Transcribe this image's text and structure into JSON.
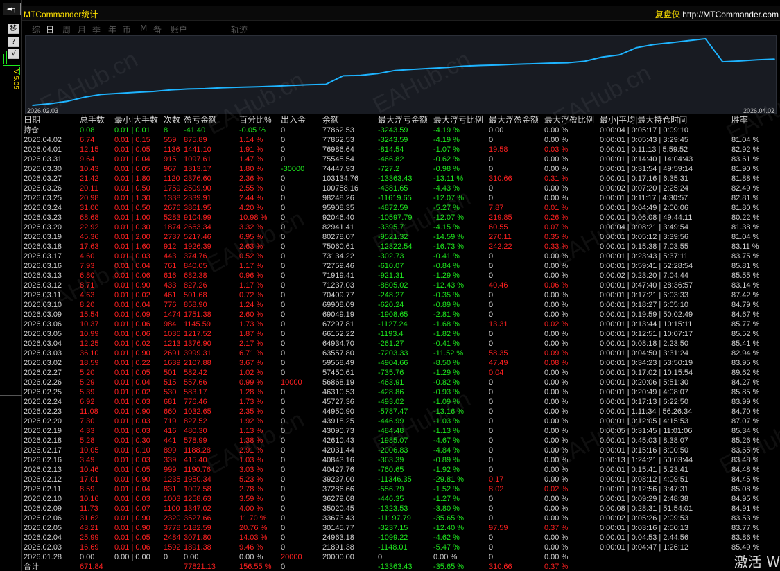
{
  "app": {
    "title": "MTCommander统计",
    "brand_name": "复盘侠",
    "brand_url": "http://MTCommander.com"
  },
  "sidebar": {
    "top_button": "◄┐",
    "btn1": "移",
    "btn2": "?",
    "btn3": "√",
    "vtext": "V 5.05"
  },
  "tabs": [
    {
      "label": "综"
    },
    {
      "label": "日"
    },
    {
      "label": "周"
    },
    {
      "label": "月"
    },
    {
      "label": "季"
    },
    {
      "label": "年"
    },
    {
      "label": "币"
    },
    {
      "label": "M"
    },
    {
      "label": "备"
    },
    {
      "label": "账户"
    },
    {
      "label": "轨迹"
    }
  ],
  "active_tab": "日",
  "colors": {
    "line": "#1eb4ff",
    "up": "#1ee81e",
    "down": "#ff2020",
    "title": "#ffe100"
  },
  "chart_data": {
    "type": "line",
    "x_start": "2026.02.03",
    "x_end": "2026.04.02",
    "x": [
      "2026.01.28",
      "2026.02.03",
      "2026.02.04",
      "2026.02.05",
      "2026.02.06",
      "2026.02.09",
      "2026.02.10",
      "2026.02.11",
      "2026.02.12",
      "2026.02.13",
      "2026.02.16",
      "2026.02.17",
      "2026.02.18",
      "2026.02.19",
      "2026.02.20",
      "2026.02.23",
      "2026.02.24",
      "2026.02.25",
      "2026.02.26",
      "2026.02.27",
      "2026.03.02",
      "2026.03.03",
      "2026.03.04",
      "2026.03.05",
      "2026.03.06",
      "2026.03.09",
      "2026.03.10",
      "2026.03.11",
      "2026.03.12",
      "2026.03.13",
      "2026.03.16",
      "2026.03.17",
      "2026.03.18",
      "2026.03.19",
      "2026.03.20",
      "2026.03.23",
      "2026.03.24",
      "2026.03.25",
      "2026.03.26",
      "2026.03.27",
      "2026.03.30",
      "2026.03.31",
      "2026.04.01",
      "2026.04.02"
    ],
    "values": [
      20000.0,
      21891.38,
      24963.18,
      30145.77,
      33673.43,
      35020.45,
      36279.08,
      37286.66,
      39237.0,
      40427.76,
      40843.16,
      42031.44,
      42610.43,
      43090.73,
      43918.25,
      44950.9,
      45727.36,
      46310.53,
      56868.19,
      57450.61,
      59558.49,
      63557.8,
      64934.7,
      66152.22,
      67297.81,
      69049.19,
      69908.09,
      70409.77,
      71237.03,
      71919.41,
      72759.46,
      73134.22,
      75060.61,
      80278.07,
      82941.41,
      92046.4,
      95908.35,
      98248.26,
      100758.16,
      103134.76,
      74447.93,
      75545.54,
      76986.64,
      77862.53
    ],
    "grid": false
  },
  "table": {
    "headers": [
      "日期",
      "总手数",
      "最小|大手数",
      "次数",
      "盈亏金额",
      "百分比%",
      "出入金",
      "余额",
      "最大浮亏金额",
      "最大浮亏比例",
      "最大浮盈金额",
      "最大浮盈比例",
      "最小|平均|最大持仓时间",
      "胜率"
    ],
    "holding": [
      "持仓",
      "0.08",
      "0.01 | 0.01",
      "8",
      "-41.40",
      "-0.05 %",
      "0",
      "77862.53",
      "-3243.59",
      "-4.19 %",
      "0.00",
      "0.00 %",
      "0:00:04 | 0:05:17 | 0:09:10",
      ""
    ],
    "rows": [
      [
        "2026.04.02",
        "6.74",
        "0.01 | 0.15",
        "559",
        "875.89",
        "1.14 %",
        "0",
        "77862.53",
        "-3243.59",
        "-4.19 %",
        "0",
        "0.00 %",
        "0:00:01 | 0:05:43 | 3:29:45",
        "81.04 %"
      ],
      [
        "2026.04.01",
        "12.15",
        "0.01 | 0.05",
        "1136",
        "1441.10",
        "1.91 %",
        "0",
        "76986.64",
        "-814.54",
        "-1.07 %",
        "19.58",
        "0.03 %",
        "0:00:01 | 0:11:13 | 5:59:52",
        "82.92 %"
      ],
      [
        "2026.03.31",
        "9.64",
        "0.01 | 0.04",
        "915",
        "1097.61",
        "1.47 %",
        "0",
        "75545.54",
        "-466.82",
        "-0.62 %",
        "0",
        "0.00 %",
        "0:00:01 | 0:14:40 | 14:04:43",
        "83.61 %"
      ],
      [
        "2026.03.30",
        "10.43",
        "0.01 | 0.05",
        "967",
        "1313.17",
        "1.80 %",
        "-30000",
        "74447.93",
        "-727.2",
        "-0.98 %",
        "0",
        "0.00 %",
        "0:00:01 | 0:31:54 | 49:59:14",
        "81.90 %"
      ],
      [
        "2026.03.27",
        "21.42",
        "0.01 | 1.80",
        "1120",
        "2376.60",
        "2.36 %",
        "0",
        "103134.76",
        "-13363.43",
        "-13.11 %",
        "310.66",
        "0.31 %",
        "0:00:01 | 0:17:16 | 6:35:31",
        "81.88 %"
      ],
      [
        "2026.03.26",
        "20.11",
        "0.01 | 0.50",
        "1759",
        "2509.90",
        "2.55 %",
        "0",
        "100758.16",
        "-4381.65",
        "-4.43 %",
        "0",
        "0.00 %",
        "0:00:02 | 0:07:20 | 2:25:24",
        "82.49 %"
      ],
      [
        "2026.03.25",
        "20.98",
        "0.01 | 1.30",
        "1338",
        "2339.91",
        "2.44 %",
        "0",
        "98248.26",
        "-11619.65",
        "-12.07 %",
        "0",
        "0.00 %",
        "0:00:01 | 0:11:17 | 4:30:57",
        "82.81 %"
      ],
      [
        "2026.03.24",
        "31.00",
        "0.01 | 0.50",
        "2676",
        "3861.95",
        "4.20 %",
        "0",
        "95908.35",
        "-4872.59",
        "-5.27 %",
        "7.87",
        "0.01 %",
        "0:00:01 | 0:04:49 | 2:00:06",
        "81.80 %"
      ],
      [
        "2026.03.23",
        "68.68",
        "0.01 | 1.00",
        "5283",
        "9104.99",
        "10.98 %",
        "0",
        "92046.40",
        "-10597.79",
        "-12.07 %",
        "219.85",
        "0.26 %",
        "0:00:01 | 0:06:08 | 49:44:11",
        "80.22 %"
      ],
      [
        "2026.03.20",
        "22.92",
        "0.01 | 0.30",
        "1874",
        "2663.34",
        "3.32 %",
        "0",
        "82941.41",
        "-3395.71",
        "-4.15 %",
        "60.55",
        "0.07 %",
        "0:00:04 | 0:08:21 | 3:49:54",
        "81.38 %"
      ],
      [
        "2026.03.19",
        "45.36",
        "0.01 | 2.00",
        "2737",
        "5217.46",
        "6.95 %",
        "0",
        "80278.07",
        "-9521.32",
        "-14.59 %",
        "270.11",
        "0.35 %",
        "0:00:01 | 0:05:12 | 3:39:56",
        "81.04 %"
      ],
      [
        "2026.03.18",
        "17.63",
        "0.01 | 1.60",
        "912",
        "1926.39",
        "2.63 %",
        "0",
        "75060.61",
        "-12322.54",
        "-16.73 %",
        "242.22",
        "0.33 %",
        "0:00:01 | 0:15:38 | 7:03:55",
        "83.11 %"
      ],
      [
        "2026.03.17",
        "4.60",
        "0.01 | 0.03",
        "443",
        "374.76",
        "0.52 %",
        "0",
        "73134.22",
        "-302.73",
        "-0.41 %",
        "0",
        "0.00 %",
        "0:00:01 | 0:23:43 | 5:37:11",
        "83.75 %"
      ],
      [
        "2026.03.16",
        "7.93",
        "0.01 | 0.04",
        "761",
        "840.05",
        "1.17 %",
        "0",
        "72759.46",
        "-610.07",
        "-0.84 %",
        "0",
        "0.00 %",
        "0:00:01 | 0:59:41 | 52:28:54",
        "85.81 %"
      ],
      [
        "2026.03.13",
        "6.80",
        "0.01 | 0.06",
        "616",
        "682.38",
        "0.96 %",
        "0",
        "71919.41",
        "-921.31",
        "-1.29 %",
        "0",
        "0.00 %",
        "0:00:02 | 0:23:20 | 7:04:44",
        "85.55 %"
      ],
      [
        "2026.03.12",
        "8.71",
        "0.01 | 0.90",
        "433",
        "827.26",
        "1.17 %",
        "0",
        "71237.03",
        "-8805.02",
        "-12.43 %",
        "40.46",
        "0.06 %",
        "0:00:01 | 0:47:40 | 28:36:57",
        "83.14 %"
      ],
      [
        "2026.03.11",
        "4.63",
        "0.01 | 0.02",
        "461",
        "501.68",
        "0.72 %",
        "0",
        "70409.77",
        "-248.27",
        "-0.35 %",
        "0",
        "0.00 %",
        "0:00:01 | 0:17:21 | 6:03:33",
        "87.42 %"
      ],
      [
        "2026.03.10",
        "8.20",
        "0.01 | 0.04",
        "776",
        "858.90",
        "1.24 %",
        "0",
        "69908.09",
        "-620.24",
        "-0.89 %",
        "0",
        "0.00 %",
        "0:00:01 | 0:18:27 | 6:05:10",
        "84.79 %"
      ],
      [
        "2026.03.09",
        "15.54",
        "0.01 | 0.09",
        "1474",
        "1751.38",
        "2.60 %",
        "0",
        "69049.19",
        "-1908.65",
        "-2.81 %",
        "0",
        "0.00 %",
        "0:00:01 | 0:19:59 | 50:02:49",
        "84.67 %"
      ],
      [
        "2026.03.06",
        "10.37",
        "0.01 | 0.06",
        "984",
        "1145.59",
        "1.73 %",
        "0",
        "67297.81",
        "-1127.24",
        "-1.68 %",
        "13.31",
        "0.02 %",
        "0:00:01 | 0:13:44 | 10:15:11",
        "85.77 %"
      ],
      [
        "2026.03.05",
        "10.99",
        "0.01 | 0.06",
        "1036",
        "1217.52",
        "1.87 %",
        "0",
        "66152.22",
        "-1193.4",
        "-1.82 %",
        "0",
        "0.00 %",
        "0:00:01 | 0:12:51 | 10:07:17",
        "85.52 %"
      ],
      [
        "2026.03.04",
        "12.25",
        "0.01 | 0.02",
        "1213",
        "1376.90",
        "2.17 %",
        "0",
        "64934.70",
        "-261.27",
        "-0.41 %",
        "0",
        "0.00 %",
        "0:00:01 | 0:08:18 | 2:23:50",
        "85.41 %"
      ],
      [
        "2026.03.03",
        "36.10",
        "0.01 | 0.90",
        "2691",
        "3999.31",
        "6.71 %",
        "0",
        "63557.80",
        "-7203.33",
        "-11.52 %",
        "58.35",
        "0.09 %",
        "0:00:01 | 0:04:50 | 3:31:24",
        "82.94 %"
      ],
      [
        "2026.03.02",
        "18.59",
        "0.01 | 0.22",
        "1639",
        "2107.88",
        "3.67 %",
        "0",
        "59558.49",
        "-4904.66",
        "-8.50 %",
        "47.49",
        "0.08 %",
        "0:00:01 | 0:34:23 | 53:50:19",
        "83.95 %"
      ],
      [
        "2026.02.27",
        "5.20",
        "0.01 | 0.05",
        "501",
        "582.42",
        "1.02 %",
        "0",
        "57450.61",
        "-735.76",
        "-1.29 %",
        "0.04",
        "0.00 %",
        "0:00:01 | 0:17:02 | 10:15:54",
        "89.62 %"
      ],
      [
        "2026.02.26",
        "5.29",
        "0.01 | 0.04",
        "515",
        "557.66",
        "0.99 %",
        "10000",
        "56868.19",
        "-463.91",
        "-0.82 %",
        "0",
        "0.00 %",
        "0:00:01 | 0:20:06 | 5:51:30",
        "84.27 %"
      ],
      [
        "2026.02.25",
        "5.39",
        "0.01 | 0.02",
        "530",
        "583.17",
        "1.28 %",
        "0",
        "46310.53",
        "-428.86",
        "-0.93 %",
        "0",
        "0.00 %",
        "0:00:01 | 0:20:49 | 4:08:07",
        "85.85 %"
      ],
      [
        "2026.02.24",
        "6.92",
        "0.01 | 0.03",
        "681",
        "776.46",
        "1.73 %",
        "0",
        "45727.36",
        "-493.02",
        "-1.09 %",
        "0",
        "0.00 %",
        "0:00:01 | 0:17:13 | 6:22:50",
        "83.99 %"
      ],
      [
        "2026.02.23",
        "11.08",
        "0.01 | 0.90",
        "660",
        "1032.65",
        "2.35 %",
        "0",
        "44950.90",
        "-5787.47",
        "-13.16 %",
        "0",
        "0.00 %",
        "0:00:01 | 1:11:34 | 56:26:34",
        "84.70 %"
      ],
      [
        "2026.02.20",
        "7.30",
        "0.01 | 0.03",
        "719",
        "827.52",
        "1.92 %",
        "0",
        "43918.25",
        "-446.99",
        "-1.03 %",
        "0",
        "0.00 %",
        "0:00:01 | 0:12:05 | 4:15:53",
        "87.07 %"
      ],
      [
        "2026.02.19",
        "4.33",
        "0.01 | 0.03",
        "416",
        "480.30",
        "1.13 %",
        "0",
        "43090.73",
        "-484.48",
        "-1.13 %",
        "0",
        "0.00 %",
        "0:00:05 | 0:31:45 | 11:01:06",
        "85.34 %"
      ],
      [
        "2026.02.18",
        "5.28",
        "0.01 | 0.30",
        "441",
        "578.99",
        "1.38 %",
        "0",
        "42610.43",
        "-1985.07",
        "-4.67 %",
        "0",
        "0.00 %",
        "0:00:01 | 0:45:03 | 8:38:07",
        "85.26 %"
      ],
      [
        "2026.02.17",
        "10.05",
        "0.01 | 0.10",
        "899",
        "1188.28",
        "2.91 %",
        "0",
        "42031.44",
        "-2006.83",
        "-4.84 %",
        "0",
        "0.00 %",
        "0:00:01 | 0:15:16 | 8:00:50",
        "83.65 %"
      ],
      [
        "2026.02.16",
        "3.49",
        "0.01 | 0.03",
        "339",
        "415.40",
        "1.03 %",
        "0",
        "40843.16",
        "-363.39",
        "-0.89 %",
        "0",
        "0.00 %",
        "0:00:13 | 1:24:21 | 50:03:44",
        "83.48 %"
      ],
      [
        "2026.02.13",
        "10.46",
        "0.01 | 0.05",
        "999",
        "1190.76",
        "3.03 %",
        "0",
        "40427.76",
        "-760.65",
        "-1.92 %",
        "0",
        "0.00 %",
        "0:00:01 | 0:15:41 | 5:23:41",
        "84.48 %"
      ],
      [
        "2026.02.12",
        "17.01",
        "0.01 | 0.90",
        "1235",
        "1950.34",
        "5.23 %",
        "0",
        "39237.00",
        "-11346.35",
        "-29.81 %",
        "0.17",
        "0.00 %",
        "0:00:01 | 0:08:12 | 4:09:51",
        "84.45 %"
      ],
      [
        "2026.02.11",
        "8.59",
        "0.01 | 0.04",
        "831",
        "1007.58",
        "2.78 %",
        "0",
        "37286.66",
        "-556.79",
        "-1.52 %",
        "8.02",
        "0.02 %",
        "0:00:01 | 0:12:56 | 3:47:31",
        "85.08 %"
      ],
      [
        "2026.02.10",
        "10.16",
        "0.01 | 0.03",
        "1003",
        "1258.63",
        "3.59 %",
        "0",
        "36279.08",
        "-446.35",
        "-1.27 %",
        "0",
        "0.00 %",
        "0:00:01 | 0:09:29 | 2:48:38",
        "84.95 %"
      ],
      [
        "2026.02.09",
        "11.73",
        "0.01 | 0.07",
        "1100",
        "1347.02",
        "4.00 %",
        "0",
        "35020.45",
        "-1323.53",
        "-3.80 %",
        "0",
        "0.00 %",
        "0:00:08 | 0:28:31 | 51:54:01",
        "84.91 %"
      ],
      [
        "2026.02.06",
        "31.62",
        "0.01 | 0.90",
        "2320",
        "3527.66",
        "11.70 %",
        "0",
        "33673.43",
        "-11197.79",
        "-35.65 %",
        "0",
        "0.00 %",
        "0:00:02 | 0:05:26 | 2:09:53",
        "83.53 %"
      ],
      [
        "2026.02.05",
        "43.21",
        "0.01 | 0.90",
        "3778",
        "5182.59",
        "20.76 %",
        "0",
        "30145.77",
        "-3237.15",
        "-12.40 %",
        "97.59",
        "0.37 %",
        "0:00:01 | 0:03:16 | 2:50:13",
        "83.77 %"
      ],
      [
        "2026.02.04",
        "25.99",
        "0.01 | 0.05",
        "2484",
        "3071.80",
        "14.03 %",
        "0",
        "24963.18",
        "-1099.22",
        "-4.62 %",
        "0",
        "0.00 %",
        "0:00:01 | 0:04:53 | 2:44:56",
        "83.86 %"
      ],
      [
        "2026.02.03",
        "16.69",
        "0.01 | 0.06",
        "1592",
        "1891.38",
        "9.46 %",
        "0",
        "21891.38",
        "-1148.01",
        "-5.47 %",
        "0",
        "0.00 %",
        "0:00:01 | 0:04:47 | 1:26:12",
        "85.49 %"
      ],
      [
        "2026.01.28",
        "0.00",
        "0.00 | 0.00",
        "0",
        "0.00",
        "0.00 %",
        "20000",
        "20000.00",
        "0",
        "0.00 %",
        "0",
        "0.00 %",
        "",
        ""
      ]
    ],
    "total": [
      "合计",
      "671.84",
      "",
      "",
      "77821.13",
      "156.55 %",
      "0",
      "",
      "-13363.43",
      "-35.65 %",
      "310.66",
      "0.37 %",
      "",
      ""
    ]
  },
  "watermark": "EAHub.cn",
  "corner_text": "激活 W"
}
